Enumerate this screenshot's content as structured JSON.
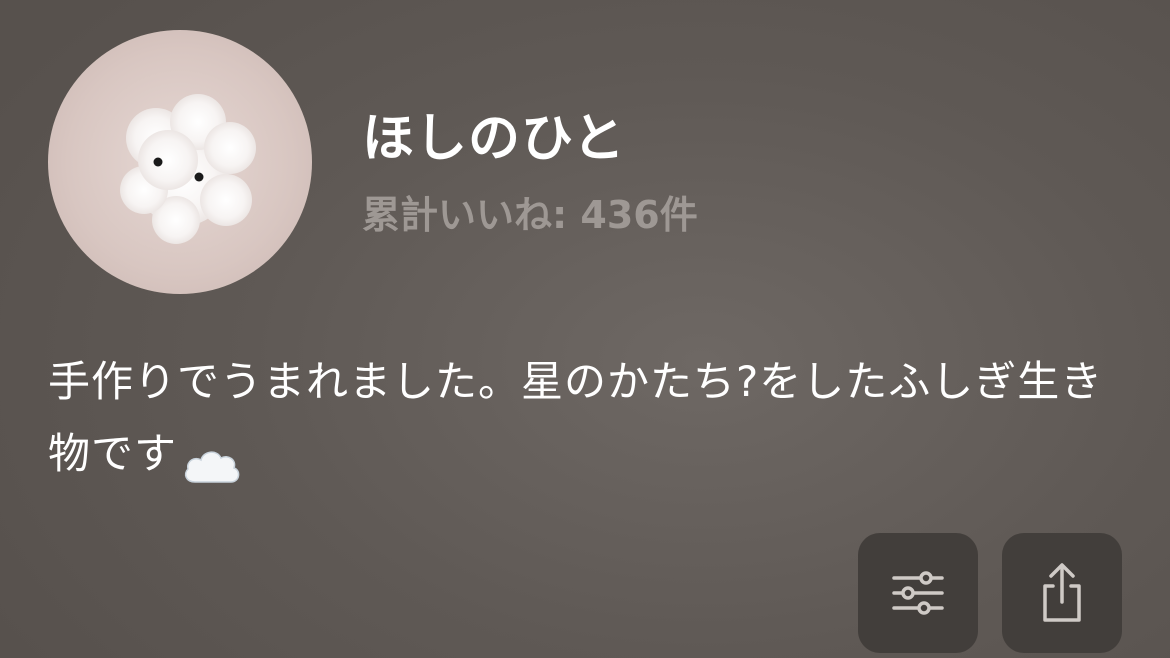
{
  "profile": {
    "username": "ほしのひと",
    "likes_text": "累計いいね: 436件",
    "bio": "手作りでうまれました。星のかたち?をしたふしぎ生き物です",
    "bio_icon": "cloud-icon"
  },
  "actions": {
    "filter_icon": "sliders-icon",
    "share_icon": "share-icon"
  },
  "colors": {
    "background": "#5f5955",
    "button_bg": "#423e3b",
    "secondary_text": "#9e9894"
  }
}
